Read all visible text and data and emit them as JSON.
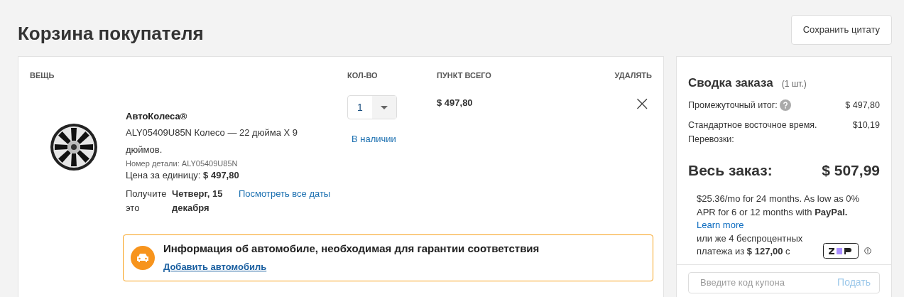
{
  "page_title": "Корзина покупателя",
  "save_button": "Сохранить цитату",
  "cart": {
    "columns": [
      "ВЕЩЬ",
      "КОЛ-ВО",
      "ПУНКТ ВСЕГО",
      "УДАЛЯТЬ"
    ],
    "items": [
      {
        "kind": "picture",
        "brand": "АвтоКолеса®",
        "name": "ALY05409U85N Колесо — 22 дюйма X 9 дюймов.",
        "part_number": "Номер детали: ALY05409U85N",
        "unit_price": "Цена за единицу: **$ 497,80**",
        "delivery_label": "Получите это",
        "delivery_date": "Четверг, 15 декабря",
        "all_dates_link": "Посмотреть все даты",
        "quantity": "1",
        "stock": "В наличии",
        "total": "$ 497,80",
        "remove": "×"
      }
    ],
    "vehicle_notice": {
      "title": "Информация об автомобиле, необходимая для гарантии соответствия",
      "link": "Добавить автомобиль"
    }
  },
  "summary": {
    "title": "Сводка заказа",
    "count": "(1 шт.)",
    "lines": [
      {
        "label": "Промежуточный итог:",
        "value": "$ 497,80",
        "help": true
      },
      {
        "label": "Стандартное восточное время. Перевозки:",
        "value": "$10,19",
        "help": false
      }
    ],
    "total_label": "Весь заказ:",
    "total_value": "$ 507,99",
    "paypal_text": "$25.36/mo for 24 months. As low as 0% APR for 6 or 12 months with **PayPal.**",
    "paypal_link": "Learn more",
    "zip_text": "или же 4 беспроцентных платежа из **$ 127,00** с",
    "coupon": {
      "placeholder": "Введите код купона",
      "button": "Подать"
    }
  }
}
